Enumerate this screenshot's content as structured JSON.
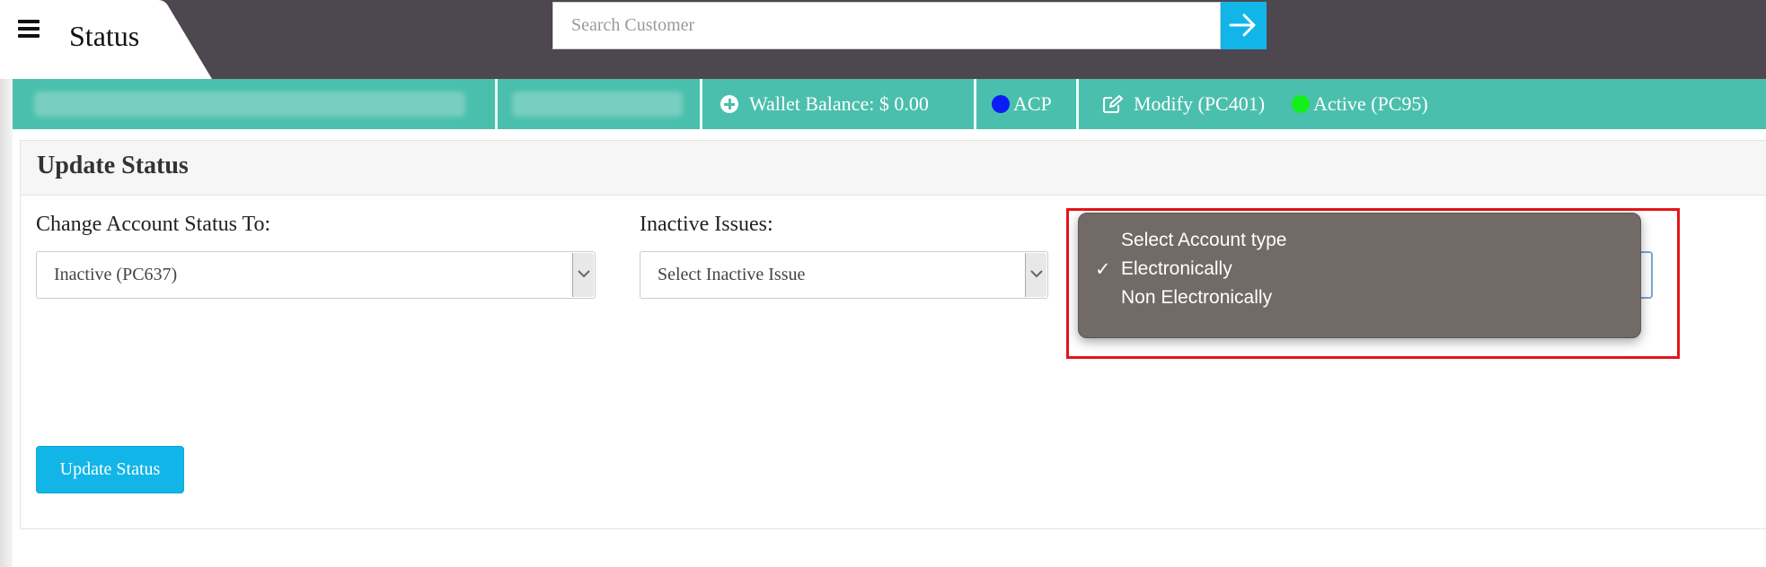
{
  "header": {
    "title": "Status",
    "menu_icon": "hamburger-icon",
    "search": {
      "placeholder": "Search Customer",
      "value": ""
    },
    "search_button_icon": "arrow-right-icon"
  },
  "infobar": {
    "wallet_label": "Wallet Balance: $ 0.00",
    "acp_label": "ACP",
    "modify_label": "Modify (PC401)",
    "active_label": "Active (PC95)",
    "colors": {
      "acp_dot": "#0b1df5",
      "active_dot": "#12f01a",
      "background": "#4bbfad"
    }
  },
  "panel": {
    "title": "Update Status",
    "fields": {
      "account_status": {
        "label": "Change Account Status To:",
        "value": "Inactive (PC637)"
      },
      "inactive_issues": {
        "label": "Inactive Issues:",
        "value": "Select Inactive Issue"
      }
    },
    "account_type_dropdown": {
      "options": [
        "Select Account type",
        "Electronically",
        "Non Electronically"
      ],
      "selected": "Electronically"
    },
    "submit_label": "Update Status"
  },
  "colors": {
    "topbar": "#4d4750",
    "accent": "#12b5e8",
    "highlight_border": "#e3151a"
  }
}
